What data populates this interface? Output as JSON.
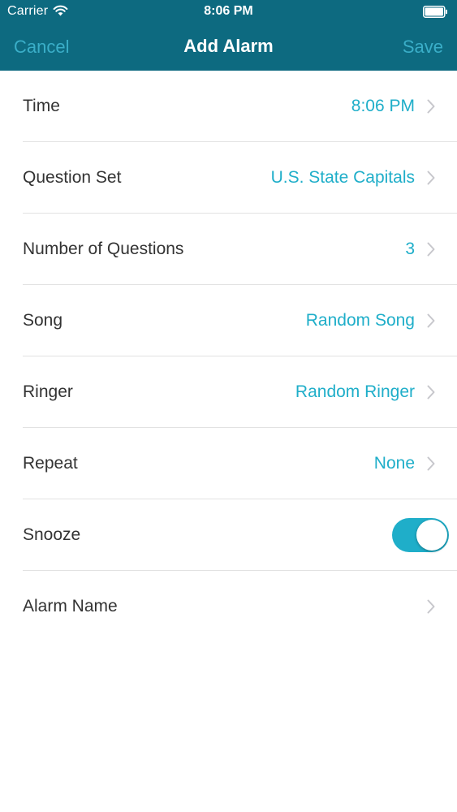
{
  "status_bar": {
    "carrier": "Carrier",
    "time": "8:06 PM",
    "icons": [
      "wifi-icon",
      "battery-icon"
    ]
  },
  "nav": {
    "cancel_label": "Cancel",
    "title": "Add Alarm",
    "save_label": "Save"
  },
  "rows": [
    {
      "label": "Time",
      "value": "8:06 PM"
    },
    {
      "label": "Question Set",
      "value": "U.S. State Capitals"
    },
    {
      "label": "Number of Questions",
      "value": "3"
    },
    {
      "label": "Song",
      "value": "Random Song"
    },
    {
      "label": "Ringer",
      "value": "Random Ringer"
    },
    {
      "label": "Repeat",
      "value": "None"
    },
    {
      "label": "Snooze",
      "toggle_on": true
    },
    {
      "label": "Alarm Name",
      "value": ""
    }
  ],
  "colors": {
    "header_bg": "#0d6a80",
    "accent": "#1faec9",
    "nav_button": "#3aaec8",
    "label_text": "#333333",
    "separator": "#e2e2e2"
  }
}
